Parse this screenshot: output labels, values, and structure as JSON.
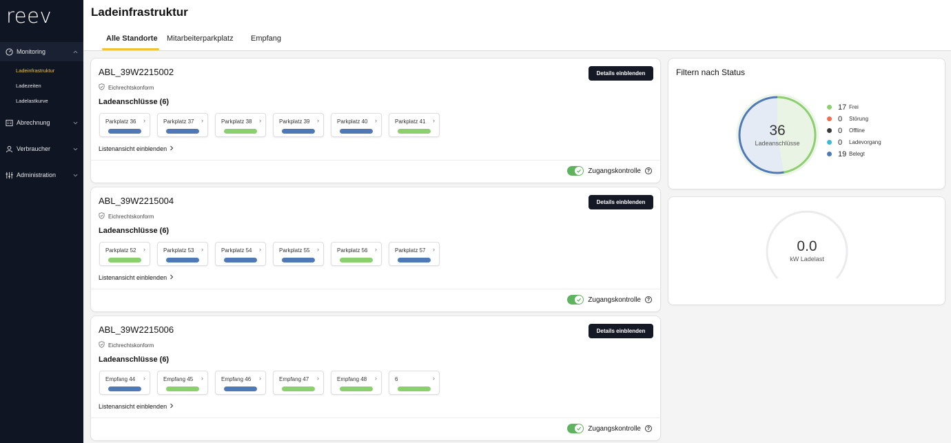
{
  "app": {
    "logo": "reev"
  },
  "sidebar": {
    "groups": [
      {
        "label": "Monitoring",
        "icon": "gauge-icon",
        "open": true
      },
      {
        "label": "Abrechnung",
        "icon": "invoice-icon",
        "open": false
      },
      {
        "label": "Verbraucher",
        "icon": "user-icon",
        "open": false
      },
      {
        "label": "Administration",
        "icon": "sliders-icon",
        "open": false
      }
    ],
    "monitoring_items": [
      {
        "label": "Ladeinfrastruktur",
        "active": true
      },
      {
        "label": "Ladezeiten",
        "active": false
      },
      {
        "label": "Ladelastkurve",
        "active": false
      }
    ]
  },
  "header": {
    "title": "Ladeinfrastruktur",
    "tabs": [
      {
        "label": "Alle Standorte",
        "active": true
      },
      {
        "label": "Mitarbeiterparkplatz",
        "active": false
      },
      {
        "label": "Empfang",
        "active": false
      }
    ]
  },
  "colors": {
    "frei": "#8ccf6e",
    "stoerung": "#f06d4f",
    "offline": "#3b3b3b",
    "ladevorgang": "#3fb8d6",
    "belegt": "#4f79b6",
    "accent": "#f2c230"
  },
  "stations": [
    {
      "name": "ABL_39W2215002",
      "calibration": "Eichrechtskonform",
      "details_label": "Details einblenden",
      "ports_title": "Ladeanschlüsse (6)",
      "ports": [
        {
          "label": "Parkplatz 36",
          "status": "belegt"
        },
        {
          "label": "Parkplatz 37",
          "status": "belegt"
        },
        {
          "label": "Parkplatz 38",
          "status": "frei"
        },
        {
          "label": "Parkplatz 39",
          "status": "belegt"
        },
        {
          "label": "Parkplatz 40",
          "status": "belegt"
        },
        {
          "label": "Parkplatz 41",
          "status": "frei"
        }
      ],
      "list_label": "Listenansicht einblenden",
      "access_label": "Zugangskontrolle",
      "access_enabled": true
    },
    {
      "name": "ABL_39W2215004",
      "calibration": "Eichrechtskonform",
      "details_label": "Details einblenden",
      "ports_title": "Ladeanschlüsse (6)",
      "ports": [
        {
          "label": "Parkplatz 52",
          "status": "frei"
        },
        {
          "label": "Parkplatz 53",
          "status": "belegt"
        },
        {
          "label": "Parkplatz 54",
          "status": "belegt"
        },
        {
          "label": "Parkplatz 55",
          "status": "belegt"
        },
        {
          "label": "Parkplatz 56",
          "status": "frei"
        },
        {
          "label": "Parkplatz 57",
          "status": "belegt"
        }
      ],
      "list_label": "Listenansicht einblenden",
      "access_label": "Zugangskontrolle",
      "access_enabled": true
    },
    {
      "name": "ABL_39W2215006",
      "calibration": "Eichrechtskonform",
      "details_label": "Details einblenden",
      "ports_title": "Ladeanschlüsse (6)",
      "ports": [
        {
          "label": "Empfang 44",
          "status": "belegt"
        },
        {
          "label": "Empfang 45",
          "status": "frei"
        },
        {
          "label": "Empfang 46",
          "status": "belegt"
        },
        {
          "label": "Empfang 47",
          "status": "frei"
        },
        {
          "label": "Empfang 48",
          "status": "frei"
        },
        {
          "label": "6",
          "status": "frei"
        }
      ],
      "list_label": "Listenansicht einblenden",
      "access_label": "Zugangskontrolle",
      "access_enabled": true
    }
  ],
  "status_filter": {
    "title": "Filtern nach Status",
    "total": "36",
    "total_label": "Ladeanschlüsse",
    "items": [
      {
        "key": "frei",
        "count": "17",
        "label": "Frei"
      },
      {
        "key": "stoerung",
        "count": "0",
        "label": "Störung"
      },
      {
        "key": "offline",
        "count": "0",
        "label": "Offline"
      },
      {
        "key": "ladevorgang",
        "count": "0",
        "label": "Ladevorgang"
      },
      {
        "key": "belegt",
        "count": "19",
        "label": "Belegt"
      }
    ]
  },
  "load": {
    "value": "0.0",
    "label": "kW Ladelast",
    "fraction": 0
  }
}
